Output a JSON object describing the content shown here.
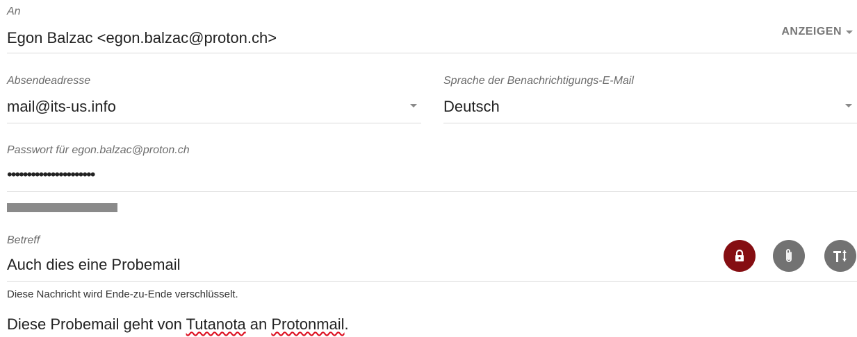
{
  "recipient": {
    "label": "An",
    "value": "Egon Balzac <egon.balzac@proton.ch>",
    "show_label": "ANZEIGEN"
  },
  "sender": {
    "label": "Absendeadresse",
    "value": "mail@its-us.info"
  },
  "language": {
    "label": "Sprache der Benachrichtigungs-E-Mail",
    "value": "Deutsch"
  },
  "password": {
    "label": "Passwort für egon.balzac@proton.ch",
    "masked": "••••••••••••••••••••••",
    "strength": 0.13
  },
  "subject": {
    "label": "Betreff",
    "value": "Auch dies eine Probemail",
    "encryption_note": "Diese Nachricht wird Ende-zu-Ende verschlüsselt."
  },
  "body": {
    "part1": "Diese Probemail geht von ",
    "word1": "Tutanota",
    "part2": " an ",
    "word2": "Protonmail",
    "part3": "."
  },
  "icons": {
    "lock": "lock-icon",
    "attach": "paperclip-icon",
    "format": "text-format-icon"
  },
  "colors": {
    "lock_active": "#850e12",
    "icon_inactive": "#727272"
  }
}
